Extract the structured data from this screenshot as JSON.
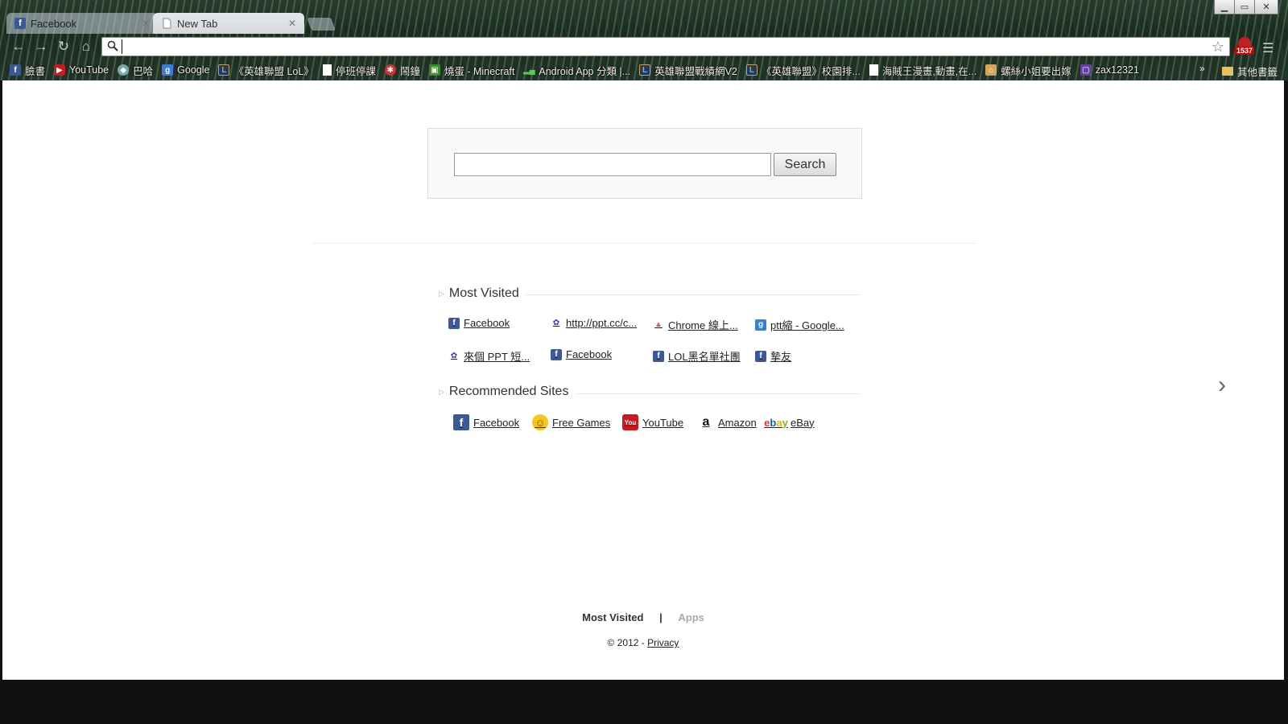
{
  "tabs": [
    {
      "label": "Facebook",
      "state": "inactive"
    },
    {
      "label": "New Tab",
      "state": "active"
    }
  ],
  "omnibox": {
    "value": ""
  },
  "extension_badge": {
    "count": "1537"
  },
  "bookmarks": [
    {
      "label": "臉書",
      "icon": "facebook-icon"
    },
    {
      "label": "YouTube",
      "icon": "youtube-icon"
    },
    {
      "label": "巴哈",
      "icon": "bahamut-icon"
    },
    {
      "label": "Google",
      "icon": "google-icon"
    },
    {
      "label": "《英雄聯盟 LoL》",
      "icon": "lol-icon"
    },
    {
      "label": "停班停課",
      "icon": "page-icon"
    },
    {
      "label": "鬧鐘",
      "icon": "alarm-icon"
    },
    {
      "label": "燒蛋 - Minecraft",
      "icon": "minecraft-icon"
    },
    {
      "label": "Android App 分類 |...",
      "icon": "android-icon"
    },
    {
      "label": "英雄聯盟戰績網V2",
      "icon": "lol-icon"
    },
    {
      "label": "《英雄聯盟》校園排...",
      "icon": "lol-icon"
    },
    {
      "label": "海賊王漫畫,動畫,在...",
      "icon": "page-icon"
    },
    {
      "label": "螺絲小姐要出嫁",
      "icon": "house-icon"
    },
    {
      "label": "zax12321",
      "icon": "twitch-icon"
    }
  ],
  "other_bookmarks": "其他書籤",
  "search": {
    "button_label": "Search",
    "value": ""
  },
  "most_visited": {
    "title": "Most Visited",
    "items": [
      {
        "label": "Facebook",
        "icon": "facebook-icon"
      },
      {
        "label": "http://ppt.cc/c...",
        "icon": "ptt-icon"
      },
      {
        "label": "Chrome 線上...",
        "icon": "chrome-store-icon"
      },
      {
        "label": "ptt縮 - Google...",
        "icon": "google-icon"
      },
      {
        "label": "來個 PPT 短...",
        "icon": "ptt-icon"
      },
      {
        "label": "Facebook",
        "icon": "facebook-icon"
      },
      {
        "label": "LOL黑名單社團",
        "icon": "facebook-icon"
      },
      {
        "label": "摯友",
        "icon": "facebook-icon"
      }
    ]
  },
  "recommended": {
    "title": "Recommended Sites",
    "items": [
      {
        "label": "Facebook",
        "icon": "facebook-icon"
      },
      {
        "label": "Free Games",
        "icon": "smiley-icon"
      },
      {
        "label": "YouTube",
        "icon": "youtube-icon"
      },
      {
        "label": "Amazon",
        "icon": "amazon-icon"
      },
      {
        "label": "eBay",
        "icon": "ebay-icon"
      }
    ]
  },
  "footer": {
    "most_visited": "Most Visited",
    "separator": "|",
    "apps": "Apps",
    "copyright": "© 2012 - ",
    "privacy": "Privacy"
  },
  "colors": {
    "facebook": "#3b5998",
    "google": "#3a7be0",
    "youtube": "#cc181e"
  }
}
